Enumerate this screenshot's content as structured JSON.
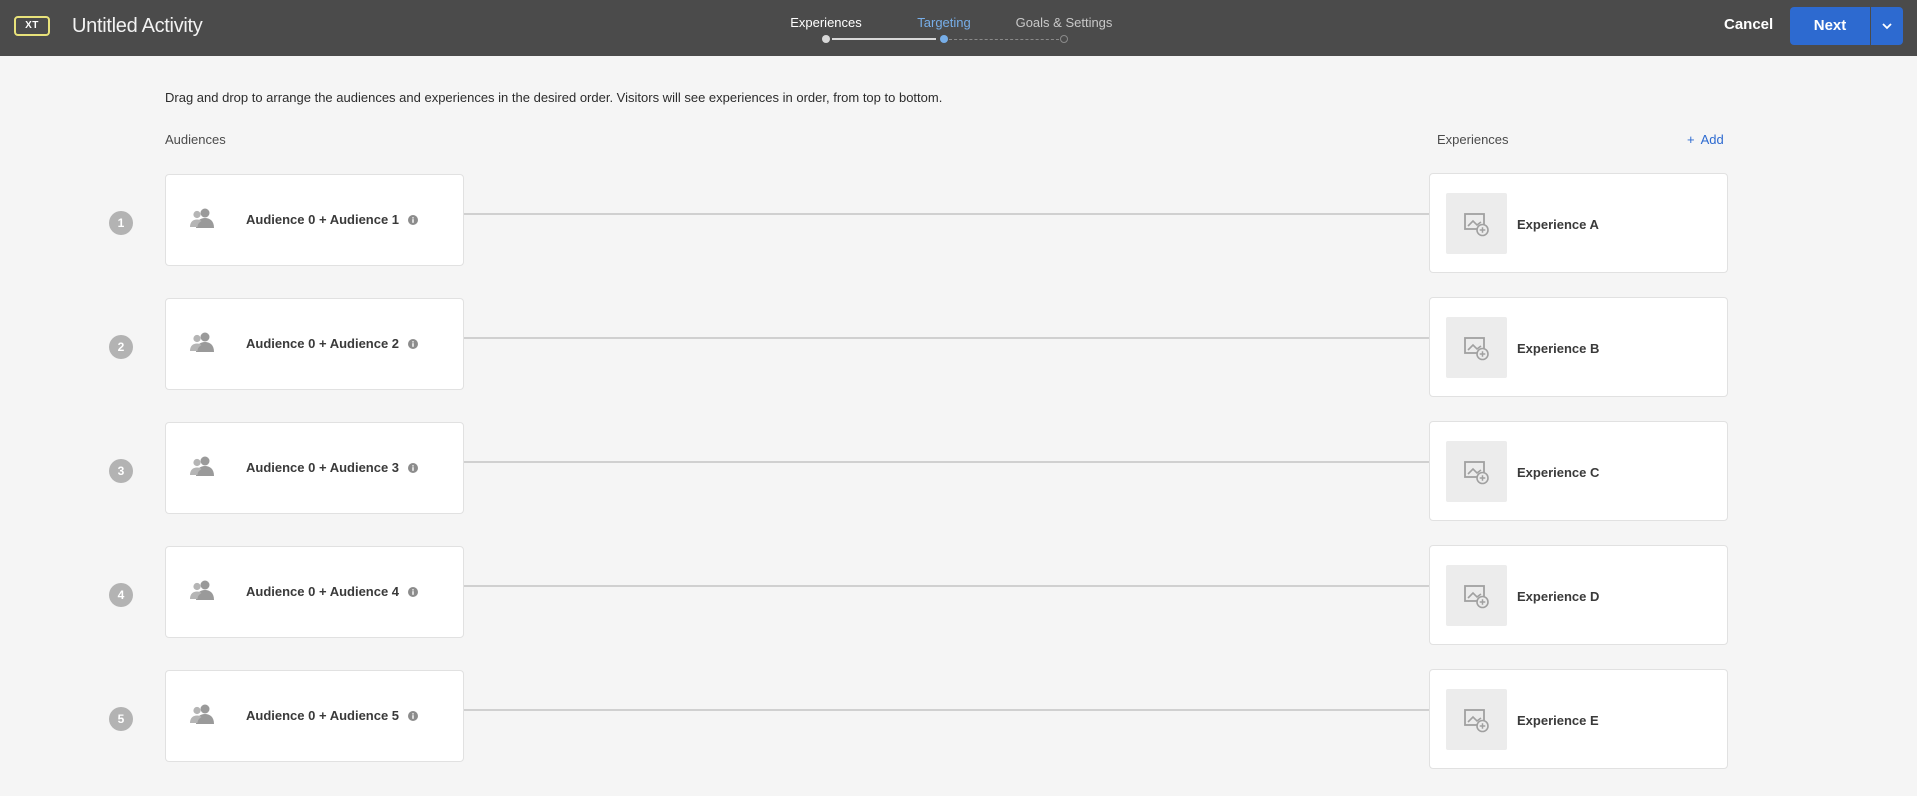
{
  "header": {
    "badge": "XT",
    "title": "Untitled Activity",
    "steps": [
      {
        "label": "Experiences",
        "state": "done"
      },
      {
        "label": "Targeting",
        "state": "current"
      },
      {
        "label": "Goals & Settings",
        "state": "future"
      }
    ],
    "cancel_label": "Cancel",
    "next_label": "Next"
  },
  "main": {
    "instructions": "Drag and drop to arrange the audiences and experiences in the desired order. Visitors will see experiences in order, from top to bottom.",
    "audiences_header": "Audiences",
    "experiences_header": "Experiences",
    "add_plus": "+",
    "add_label": "Add",
    "rows": [
      {
        "number": "1",
        "audience": "Audience 0 + Audience 1",
        "experience": "Experience A"
      },
      {
        "number": "2",
        "audience": "Audience 0 + Audience 2",
        "experience": "Experience B"
      },
      {
        "number": "3",
        "audience": "Audience 0 + Audience 3",
        "experience": "Experience C"
      },
      {
        "number": "4",
        "audience": "Audience 0 + Audience 4",
        "experience": "Experience D"
      },
      {
        "number": "5",
        "audience": "Audience 0 + Audience 5",
        "experience": "Experience E"
      }
    ]
  },
  "colors": {
    "topbar": "#4b4b4b",
    "accent_blue": "#2d6ad0",
    "current_step": "#77aee8",
    "background": "#f5f5f5"
  },
  "icons": {
    "audience": "people-icon",
    "info": "info-icon",
    "experience_thumb": "add-image-icon",
    "dropdown": "chevron-down-icon"
  }
}
